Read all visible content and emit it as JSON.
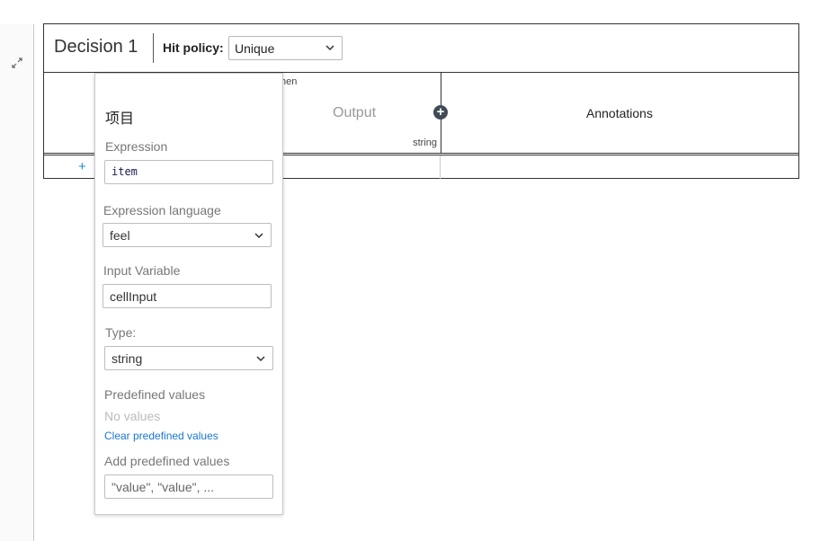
{
  "table": {
    "name": "Decision 1",
    "hit_policy_label": "Hit policy:",
    "hit_policy_value": "Unique",
    "then_label": "hen",
    "output_label": "Output",
    "output_type": "string",
    "annotations_label": "Annotations",
    "add_row_label": "+",
    "add_column_label": "+"
  },
  "popup": {
    "title": "项目",
    "expression_label": "Expression",
    "expression_value": "item",
    "language_label": "Expression language",
    "language_value": "feel",
    "input_variable_label": "Input Variable",
    "input_variable_value": "cellInput",
    "type_label": "Type:",
    "type_value": "string",
    "predefined_label": "Predefined values",
    "no_values_text": "No values",
    "clear_link": "Clear predefined values",
    "add_predefined_label": "Add predefined values",
    "add_predefined_placeholder": "\"value\", \"value\", ..."
  },
  "icons": {
    "collapse": "collapse-arrows-icon",
    "chevron": "chevron-down-icon",
    "add_column": "plus-circle-icon"
  }
}
